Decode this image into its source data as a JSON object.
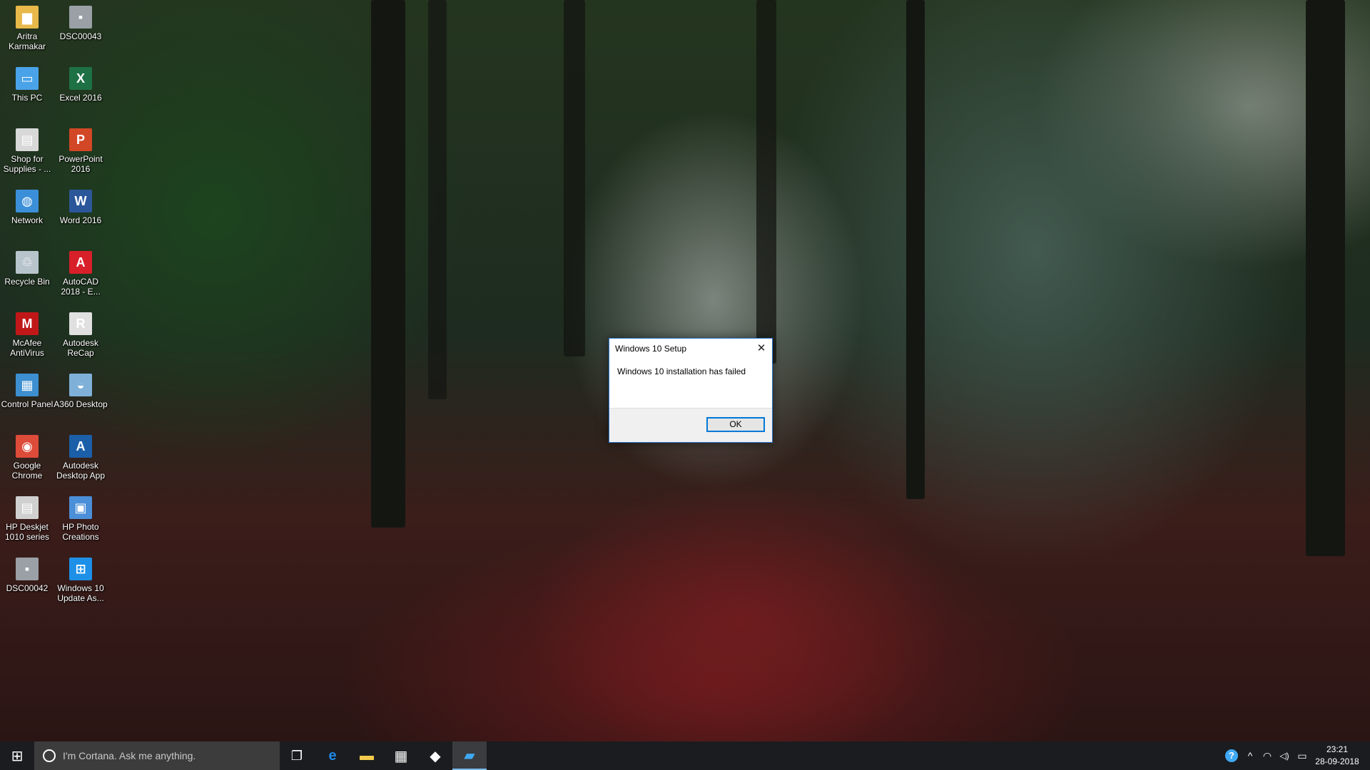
{
  "desktop": {
    "icons": [
      {
        "label": "Aritra Karmakar",
        "icon": "user-folder-icon",
        "color": "#e8b84a",
        "glyph": "▆"
      },
      {
        "label": "DSC00043",
        "icon": "image-file-icon",
        "color": "#9aa0a6",
        "glyph": "▪"
      },
      {
        "label": "This PC",
        "icon": "computer-icon",
        "color": "#4aa3e8",
        "glyph": "▭"
      },
      {
        "label": "Excel 2016",
        "icon": "excel-icon",
        "color": "#1e7145",
        "glyph": "X"
      },
      {
        "label": "Shop for Supplies - ...",
        "icon": "printer-shop-icon",
        "color": "#d8d8d8",
        "glyph": "▤"
      },
      {
        "label": "PowerPoint 2016",
        "icon": "powerpoint-icon",
        "color": "#d24726",
        "glyph": "P"
      },
      {
        "label": "Network",
        "icon": "network-icon",
        "color": "#3b8fd8",
        "glyph": "◍"
      },
      {
        "label": "Word 2016",
        "icon": "word-icon",
        "color": "#2b579a",
        "glyph": "W"
      },
      {
        "label": "Recycle Bin",
        "icon": "recycle-bin-icon",
        "color": "#b8c4cc",
        "glyph": "♲"
      },
      {
        "label": "AutoCAD 2018 - E...",
        "icon": "autocad-icon",
        "color": "#d8202a",
        "glyph": "A"
      },
      {
        "label": "McAfee AntiVirus",
        "icon": "mcafee-icon",
        "color": "#c01818",
        "glyph": "M"
      },
      {
        "label": "Autodesk ReCap",
        "icon": "autodesk-recap-icon",
        "color": "#e0e0e0",
        "glyph": "R"
      },
      {
        "label": "Control Panel",
        "icon": "control-panel-icon",
        "color": "#3d8fd0",
        "glyph": "▦"
      },
      {
        "label": "A360 Desktop",
        "icon": "a360-desktop-icon",
        "color": "#7fb0d8",
        "glyph": "◒"
      },
      {
        "label": "Google Chrome",
        "icon": "chrome-icon",
        "color": "#dd4b39",
        "glyph": "◉"
      },
      {
        "label": "Autodesk Desktop App",
        "icon": "autodesk-desktop-app-icon",
        "color": "#1b5fa8",
        "glyph": "A"
      },
      {
        "label": "HP Deskjet 1010 series",
        "icon": "printer-icon",
        "color": "#d0d0d0",
        "glyph": "▤"
      },
      {
        "label": "HP Photo Creations",
        "icon": "hp-photo-creations-icon",
        "color": "#4b8fd8",
        "glyph": "▣"
      },
      {
        "label": "DSC00042",
        "icon": "image-file-icon",
        "color": "#9aa0a6",
        "glyph": "▪"
      },
      {
        "label": "Windows 10 Update As...",
        "icon": "windows-update-assistant-icon",
        "color": "#1e90e8",
        "glyph": "⊞"
      }
    ]
  },
  "dialog": {
    "title": "Windows 10 Setup",
    "close_glyph": "✕",
    "message": "Windows 10 installation has failed",
    "ok_label": "OK"
  },
  "taskbar": {
    "start_glyph": "⊞",
    "cortana_placeholder": "I'm Cortana. Ask me anything.",
    "task_view_glyph": "❐",
    "apps": [
      {
        "name": "edge-icon",
        "glyph": "e",
        "color": "#1e88e5",
        "active": false
      },
      {
        "name": "file-explorer-icon",
        "glyph": "▬",
        "color": "#f2c94c",
        "active": false
      },
      {
        "name": "store-icon",
        "glyph": "▦",
        "color": "#ffffff",
        "active": false
      },
      {
        "name": "dropbox-icon",
        "glyph": "◆",
        "color": "#ffffff",
        "active": false
      },
      {
        "name": "windows-setup-icon",
        "glyph": "▰",
        "color": "#3fa9f5",
        "active": true
      }
    ],
    "tray": {
      "help_glyph": "?",
      "chevron_glyph": "^",
      "wifi_glyph": "◠",
      "volume_glyph": "◁)",
      "notification_glyph": "▭",
      "time": "23:21",
      "date": "28-09-2018"
    }
  }
}
